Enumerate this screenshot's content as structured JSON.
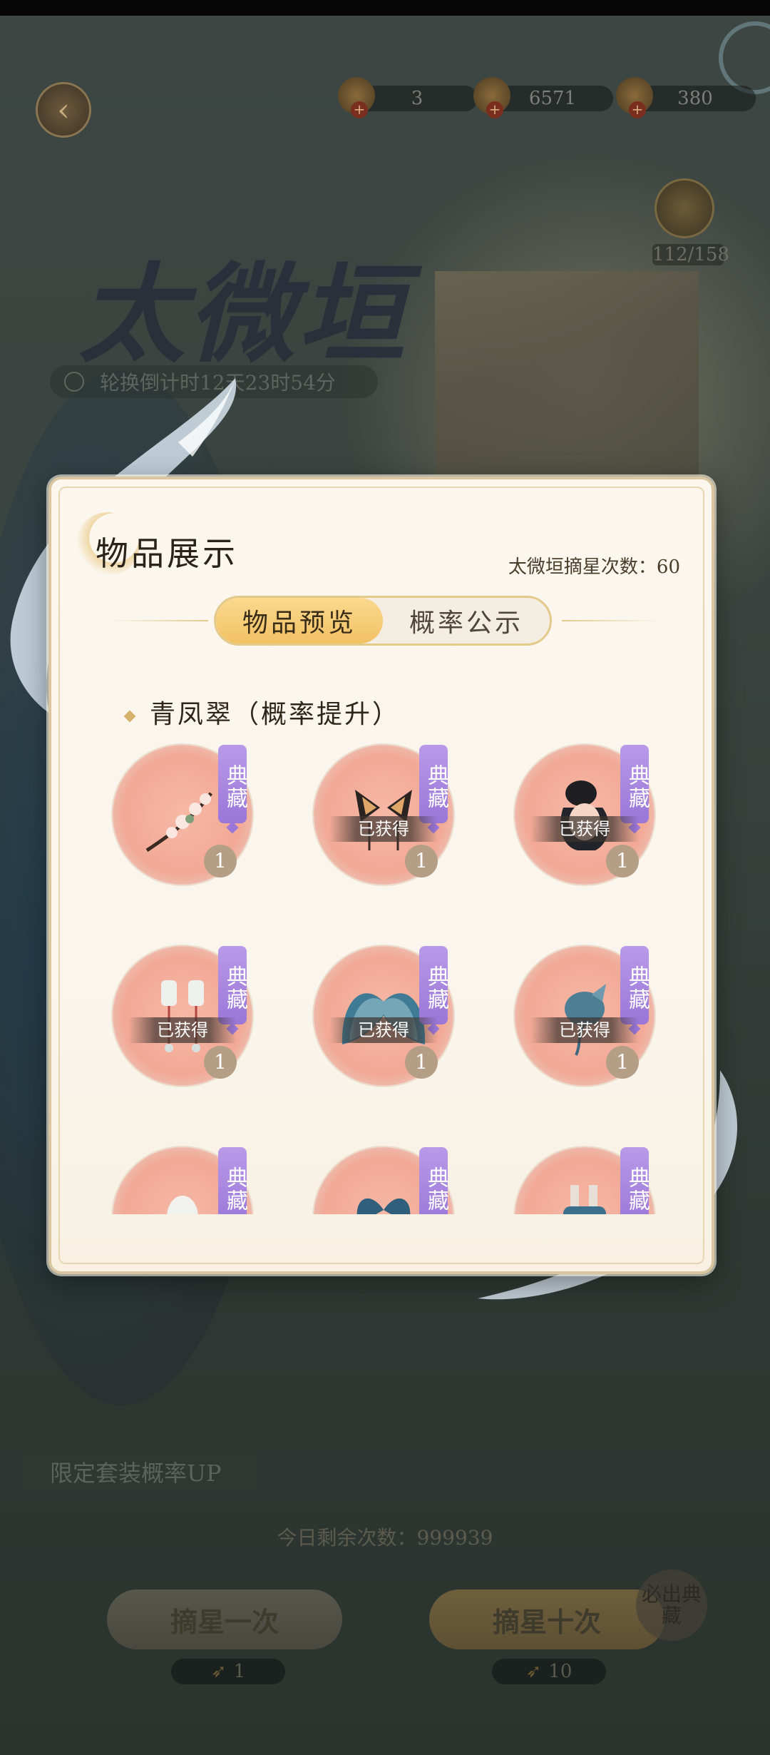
{
  "header": {
    "currencies": [
      {
        "icon": "fan-ticket-icon",
        "value": "3"
      },
      {
        "icon": "gold-coin-icon",
        "value": "6571"
      },
      {
        "icon": "pearl-icon",
        "value": "380"
      }
    ],
    "medal_progress": "112/158"
  },
  "banner": {
    "title": "太微垣",
    "countdown": "轮换倒计时12天23时54分"
  },
  "modal": {
    "title": "物品展示",
    "star_count_label": "太微垣摘星次数：60",
    "tabs": [
      {
        "label": "物品预览",
        "active": true
      },
      {
        "label": "概率公示",
        "active": false
      }
    ],
    "section_title": "青凤翠（概率提升）",
    "items": [
      {
        "name": "flower-vine-item",
        "badge": "典藏",
        "owned": "",
        "qty": "1"
      },
      {
        "name": "butterfly-hairpin-item",
        "badge": "典藏",
        "owned": "已获得",
        "qty": "1"
      },
      {
        "name": "hair-bun-item",
        "badge": "典藏",
        "owned": "已获得",
        "qty": "1"
      },
      {
        "name": "earrings-item",
        "badge": "典藏",
        "owned": "已获得",
        "qty": "1"
      },
      {
        "name": "butterfly-wings-item",
        "badge": "典藏",
        "owned": "已获得",
        "qty": "1"
      },
      {
        "name": "hair-ornament-item",
        "badge": "典藏",
        "owned": "已获得",
        "qty": "1"
      },
      {
        "name": "white-hair-item",
        "badge": "典藏",
        "owned": "",
        "qty": ""
      },
      {
        "name": "blue-butterfly-item",
        "badge": "典藏",
        "owned": "",
        "qty": ""
      },
      {
        "name": "blue-boots-item",
        "badge": "典藏",
        "owned": "",
        "qty": ""
      }
    ]
  },
  "footer": {
    "limited_up": "限定套装概率UP",
    "remaining": "今日剩余次数：999939",
    "draw_one": "摘星一次",
    "draw_ten": "摘星十次",
    "cost_one": "1",
    "cost_ten": "10",
    "stamp": "必出典藏"
  }
}
